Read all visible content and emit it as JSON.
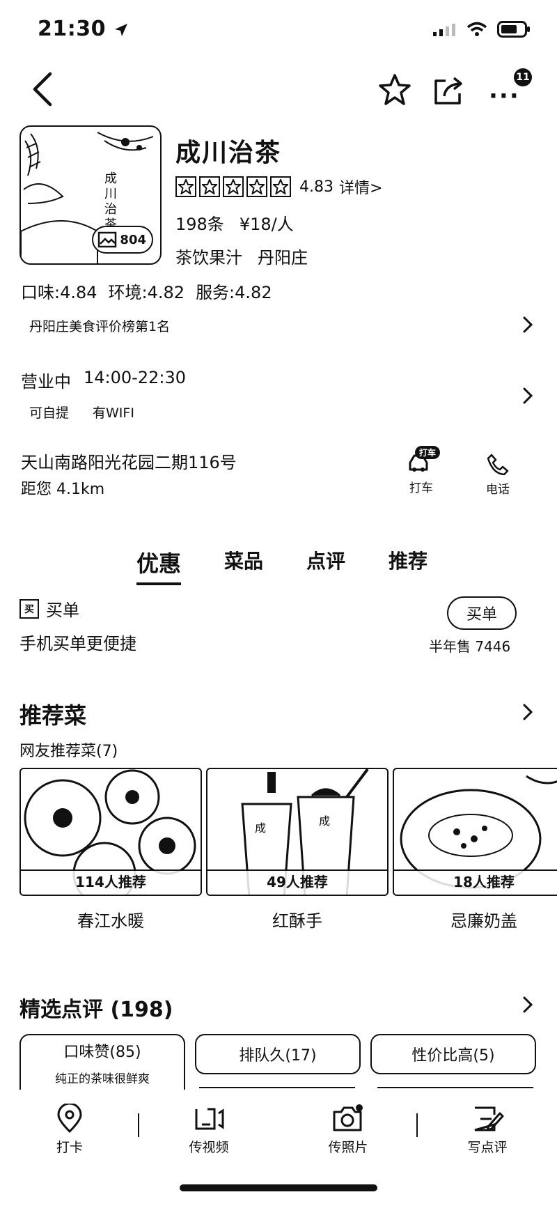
{
  "status_bar": {
    "time": "21:30"
  },
  "nav": {
    "more_badge": "11"
  },
  "shop": {
    "name": "成川治茶",
    "photo_count": "804",
    "rating": "4.83",
    "rating_detail": "详情>",
    "review_count": "198条",
    "price": "¥18/人",
    "category": "茶饮果汁",
    "area": "丹阳庄",
    "scores": {
      "taste": "口味:4.84",
      "environment": "环境:4.82",
      "service": "服务:4.82"
    },
    "rank": "丹阳庄美食评价榜第1名",
    "status": "营业中",
    "hours": "14:00-22:30",
    "facilities": [
      "可自提",
      "有WIFI"
    ],
    "address": "天山南路阳光花园二期116号",
    "distance": "距您 4.1km"
  },
  "actions": {
    "taxi_label": "打车",
    "taxi_badge": "打车",
    "phone_label": "电话"
  },
  "tabs": [
    {
      "label": "优惠",
      "active": true
    },
    {
      "label": "菜品",
      "active": false
    },
    {
      "label": "点评",
      "active": false
    },
    {
      "label": "推荐",
      "active": false
    }
  ],
  "buy": {
    "icon_text": "买",
    "title": "买单",
    "subtitle": "手机买单更便捷",
    "button": "买单",
    "sold": "半年售 7446"
  },
  "recommended": {
    "title": "推荐菜",
    "subtitle": "网友推荐菜(7)",
    "dishes": [
      {
        "name": "春江水暖",
        "badge": "114人推荐"
      },
      {
        "name": "红酥手",
        "badge": "49人推荐"
      },
      {
        "name": "忌廉奶盖",
        "badge": "18人推荐"
      }
    ]
  },
  "reviews": {
    "title": "精选点评 (198)",
    "tags": [
      {
        "label": "口味赞(85)",
        "snippet": "纯正的茶味很鲜爽"
      },
      {
        "label": "排队久(17)"
      },
      {
        "label": "性价比高(5)"
      }
    ]
  },
  "bottom_bar": [
    {
      "label": "打卡",
      "icon": "location-pin-icon"
    },
    {
      "label": "传视频",
      "icon": "video-upload-icon"
    },
    {
      "label": "传照片",
      "icon": "camera-upload-icon"
    },
    {
      "label": "写点评",
      "icon": "write-review-icon"
    }
  ]
}
